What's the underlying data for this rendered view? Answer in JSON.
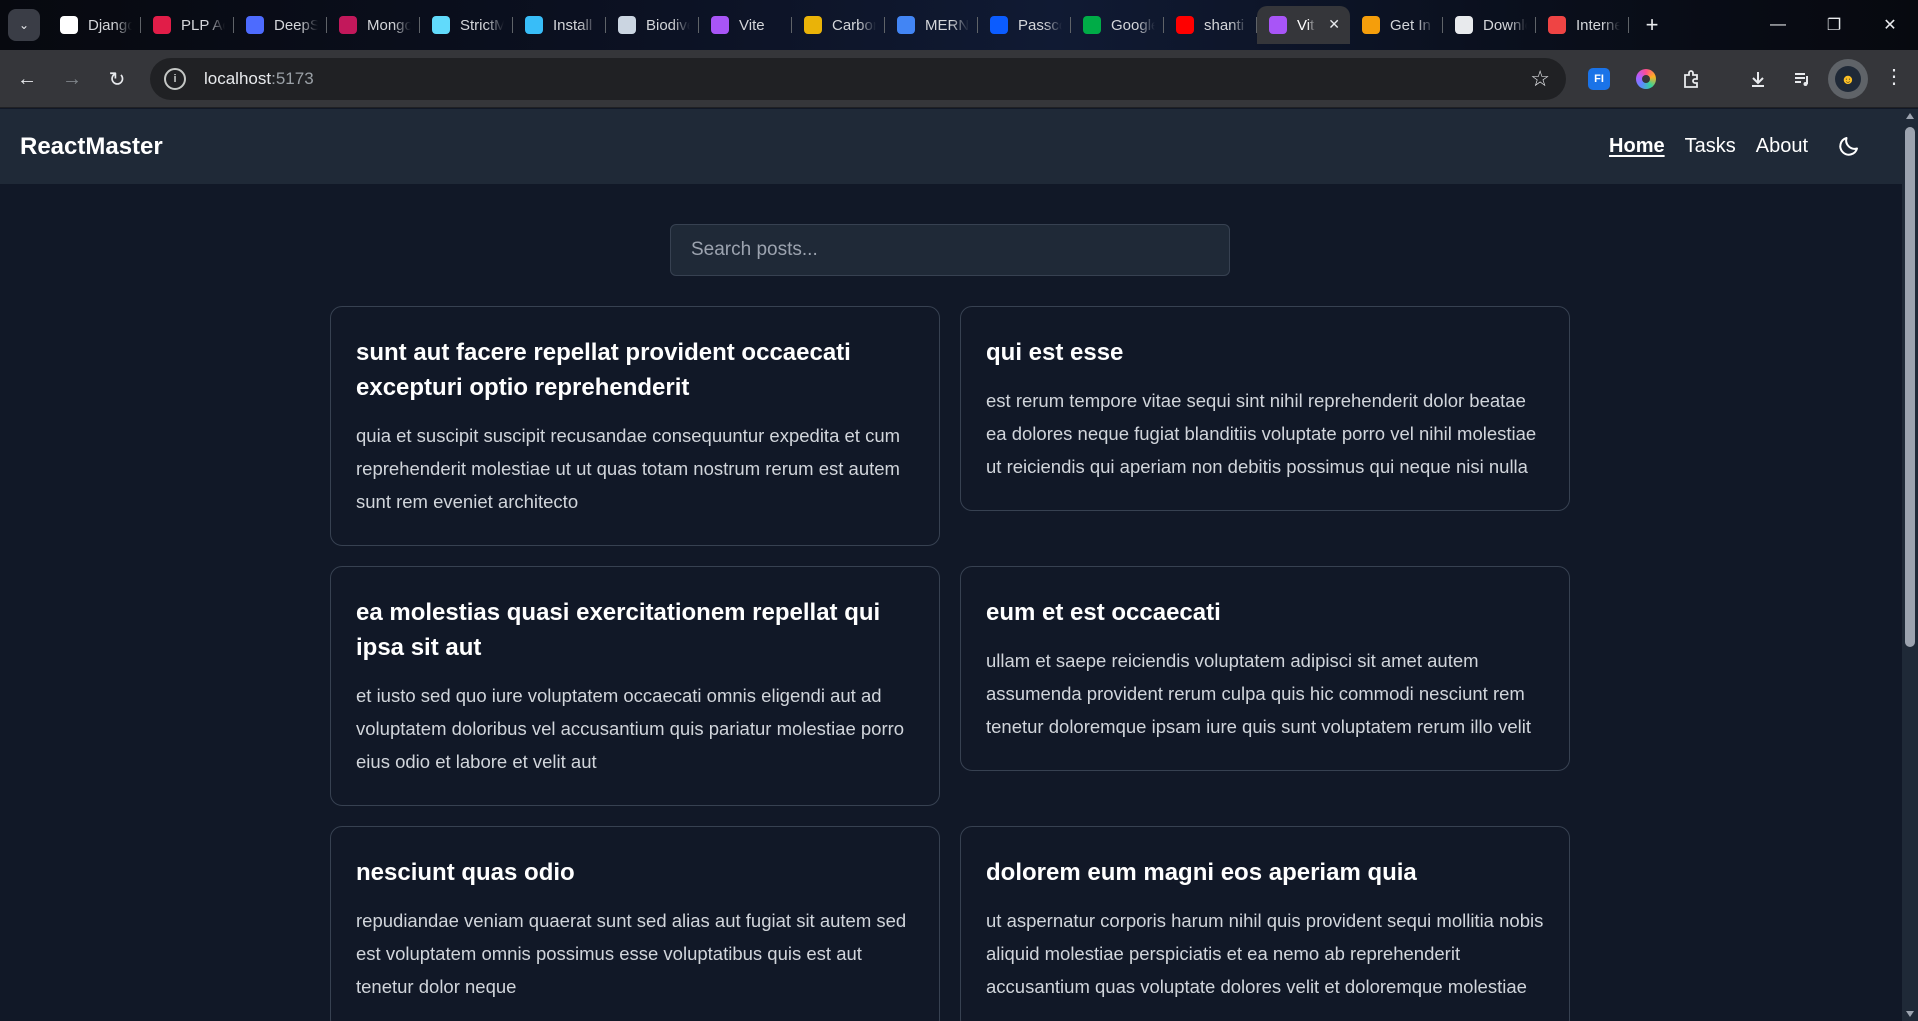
{
  "browser": {
    "tabs": [
      {
        "title": "Django",
        "icon": "django-icon",
        "color": "#ffffff"
      },
      {
        "title": "PLP Academy",
        "icon": "plp-icon",
        "color": "#e11d48"
      },
      {
        "title": "DeepSeek",
        "icon": "deepseek-icon",
        "color": "#4d6bfe"
      },
      {
        "title": "MongoDB",
        "icon": "mongodb-icon",
        "color": "#c2185b"
      },
      {
        "title": "StrictMode",
        "icon": "react-icon",
        "color": "#61dafb"
      },
      {
        "title": "Install Tailwind",
        "icon": "tailwind-icon",
        "color": "#38bdf8"
      },
      {
        "title": "Biodiversity",
        "icon": "gauge-icon",
        "color": "#cbd5e1"
      },
      {
        "title": "Vite",
        "icon": "vite-icon",
        "color": "#a855f7"
      },
      {
        "title": "Carbon",
        "icon": "carbon-icon",
        "color": "#eab308"
      },
      {
        "title": "MERN",
        "icon": "docs-icon",
        "color": "#4285f4"
      },
      {
        "title": "Passcode",
        "icon": "zoom-icon",
        "color": "#0b5cff"
      },
      {
        "title": "Google Meet",
        "icon": "meet-icon",
        "color": "#00ac47"
      },
      {
        "title": "shanti",
        "icon": "youtube-icon",
        "color": "#ff0000"
      },
      {
        "title": "Vite",
        "icon": "vite-icon",
        "color": "#a855f7",
        "active": true
      },
      {
        "title": "Get In",
        "icon": "g-icon",
        "color": "#f59e0b"
      },
      {
        "title": "Downloads",
        "icon": "download-icon",
        "color": "#e8eaed"
      },
      {
        "title": "Internet",
        "icon": "speed-icon",
        "color": "#ef4444"
      }
    ],
    "url_host": "localhost",
    "url_port": ":5173"
  },
  "app": {
    "brand": "ReactMaster",
    "nav": {
      "home": "Home",
      "tasks": "Tasks",
      "about": "About"
    },
    "search_placeholder": "Search posts...",
    "posts": [
      {
        "title": "sunt aut facere repellat provident occaecati excepturi optio reprehenderit",
        "body": "quia et suscipit suscipit recusandae consequuntur expedita et cum reprehenderit molestiae ut ut quas totam nostrum rerum est autem sunt rem eveniet architecto"
      },
      {
        "title": "qui est esse",
        "body": "est rerum tempore vitae sequi sint nihil reprehenderit dolor beatae ea dolores neque fugiat blanditiis voluptate porro vel nihil molestiae ut reiciendis qui aperiam non debitis possimus qui neque nisi nulla"
      },
      {
        "title": "ea molestias quasi exercitationem repellat qui ipsa sit aut",
        "body": "et iusto sed quo iure voluptatem occaecati omnis eligendi aut ad voluptatem doloribus vel accusantium quis pariatur molestiae porro eius odio et labore et velit aut"
      },
      {
        "title": "eum et est occaecati",
        "body": "ullam et saepe reiciendis voluptatem adipisci sit amet autem assumenda provident rerum culpa quis hic commodi nesciunt rem tenetur doloremque ipsam iure quis sunt voluptatem rerum illo velit"
      },
      {
        "title": "nesciunt quas odio",
        "body": "repudiandae veniam quaerat sunt sed alias aut fugiat sit autem sed est voluptatem omnis possimus esse voluptatibus quis est aut tenetur dolor neque"
      },
      {
        "title": "dolorem eum magni eos aperiam quia",
        "body": "ut aspernatur corporis harum nihil quis provident sequi mollitia nobis aliquid molestiae perspiciatis et ea nemo ab reprehenderit accusantium quas voluptate dolores velit et doloremque molestiae"
      }
    ]
  }
}
